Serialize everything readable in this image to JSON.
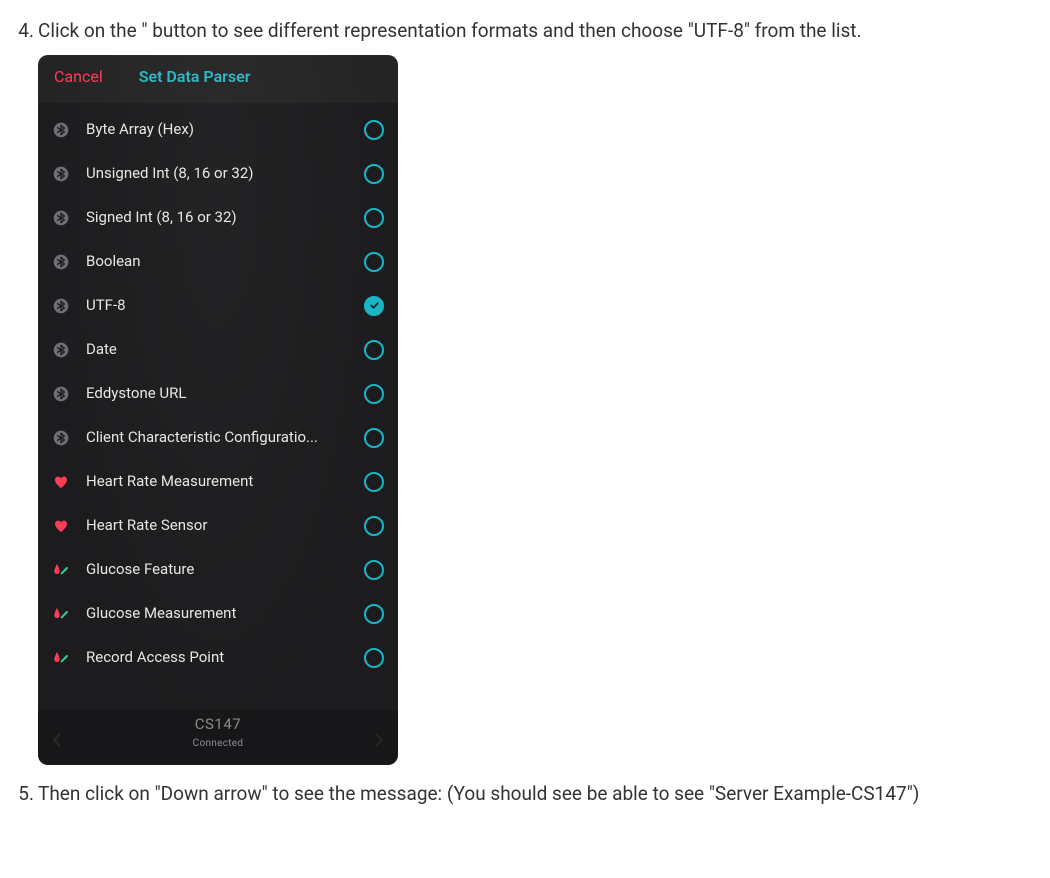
{
  "steps": {
    "four": {
      "number": "4.",
      "text": "Click on the \" button to see different representation formats and then choose \"UTF-8\" from the list."
    },
    "five": {
      "number": "5.",
      "text": "Then click on \"Down arrow\" to see the message: (You should see be able to see \"Server Example-CS147\")"
    }
  },
  "modal": {
    "cancel": "Cancel",
    "title": "Set Data Parser",
    "footer_device": "CS147",
    "footer_status": "Connected",
    "items": [
      {
        "label": "Byte Array (Hex)",
        "icon": "bluetooth",
        "selected": false
      },
      {
        "label": "Unsigned Int (8, 16 or 32)",
        "icon": "bluetooth",
        "selected": false
      },
      {
        "label": "Signed Int (8, 16 or 32)",
        "icon": "bluetooth",
        "selected": false
      },
      {
        "label": "Boolean",
        "icon": "bluetooth",
        "selected": false
      },
      {
        "label": "UTF-8",
        "icon": "bluetooth",
        "selected": true
      },
      {
        "label": "Date",
        "icon": "bluetooth",
        "selected": false
      },
      {
        "label": "Eddystone URL",
        "icon": "bluetooth",
        "selected": false
      },
      {
        "label": "Client Characteristic Configuratio...",
        "icon": "bluetooth",
        "selected": false
      },
      {
        "label": "Heart Rate Measurement",
        "icon": "heart",
        "selected": false
      },
      {
        "label": "Heart Rate Sensor",
        "icon": "heart",
        "selected": false
      },
      {
        "label": "Glucose Feature",
        "icon": "glucose",
        "selected": false
      },
      {
        "label": "Glucose Measurement",
        "icon": "glucose",
        "selected": false
      },
      {
        "label": "Record Access Point",
        "icon": "glucose",
        "selected": false
      }
    ]
  }
}
